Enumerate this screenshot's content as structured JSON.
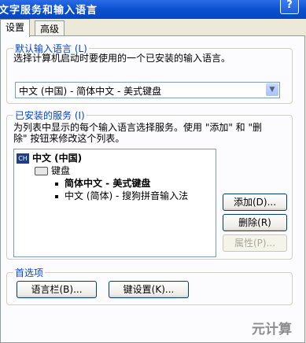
{
  "window": {
    "title": "文字服务和输入语言",
    "help_label": "?"
  },
  "tabs": [
    {
      "label": "设置",
      "active": true
    },
    {
      "label": "高级",
      "active": false
    }
  ],
  "default_lang": {
    "group_title": "默认输入语言 (L)",
    "description": "选择计算机启动时要使用的一个已安装的输入语言。",
    "selected": "中文 (中国) - 简体中文 - 美式键盘"
  },
  "installed": {
    "group_title": "已安装的服务 (I)",
    "description_line1": "为列表中显示的每个输入语言选择服务。使用 \"添加\" 和 \"删",
    "description_line2": "除\" 按钮来修改这个列表。",
    "tree": {
      "language_icon": "CH",
      "language": "中文 (中国)",
      "category": "键盘",
      "services": [
        {
          "label": "简体中文 - 美式键盘",
          "bold": true
        },
        {
          "label": "中文 (简体) - 搜狗拼音输入法",
          "bold": false
        }
      ]
    },
    "buttons": {
      "add": "添加(D)...",
      "remove": "删除(R)",
      "properties": "属性(P)..."
    }
  },
  "preferences": {
    "group_title": "首选项",
    "buttons": {
      "language_bar": "语言栏(B)...",
      "key_settings": "键设置(K)..."
    }
  },
  "watermark": "元计算",
  "icons": [
    "help-icon",
    "dropdown-arrow-icon",
    "language-icon",
    "keyboard-icon",
    "bullet-icon"
  ]
}
